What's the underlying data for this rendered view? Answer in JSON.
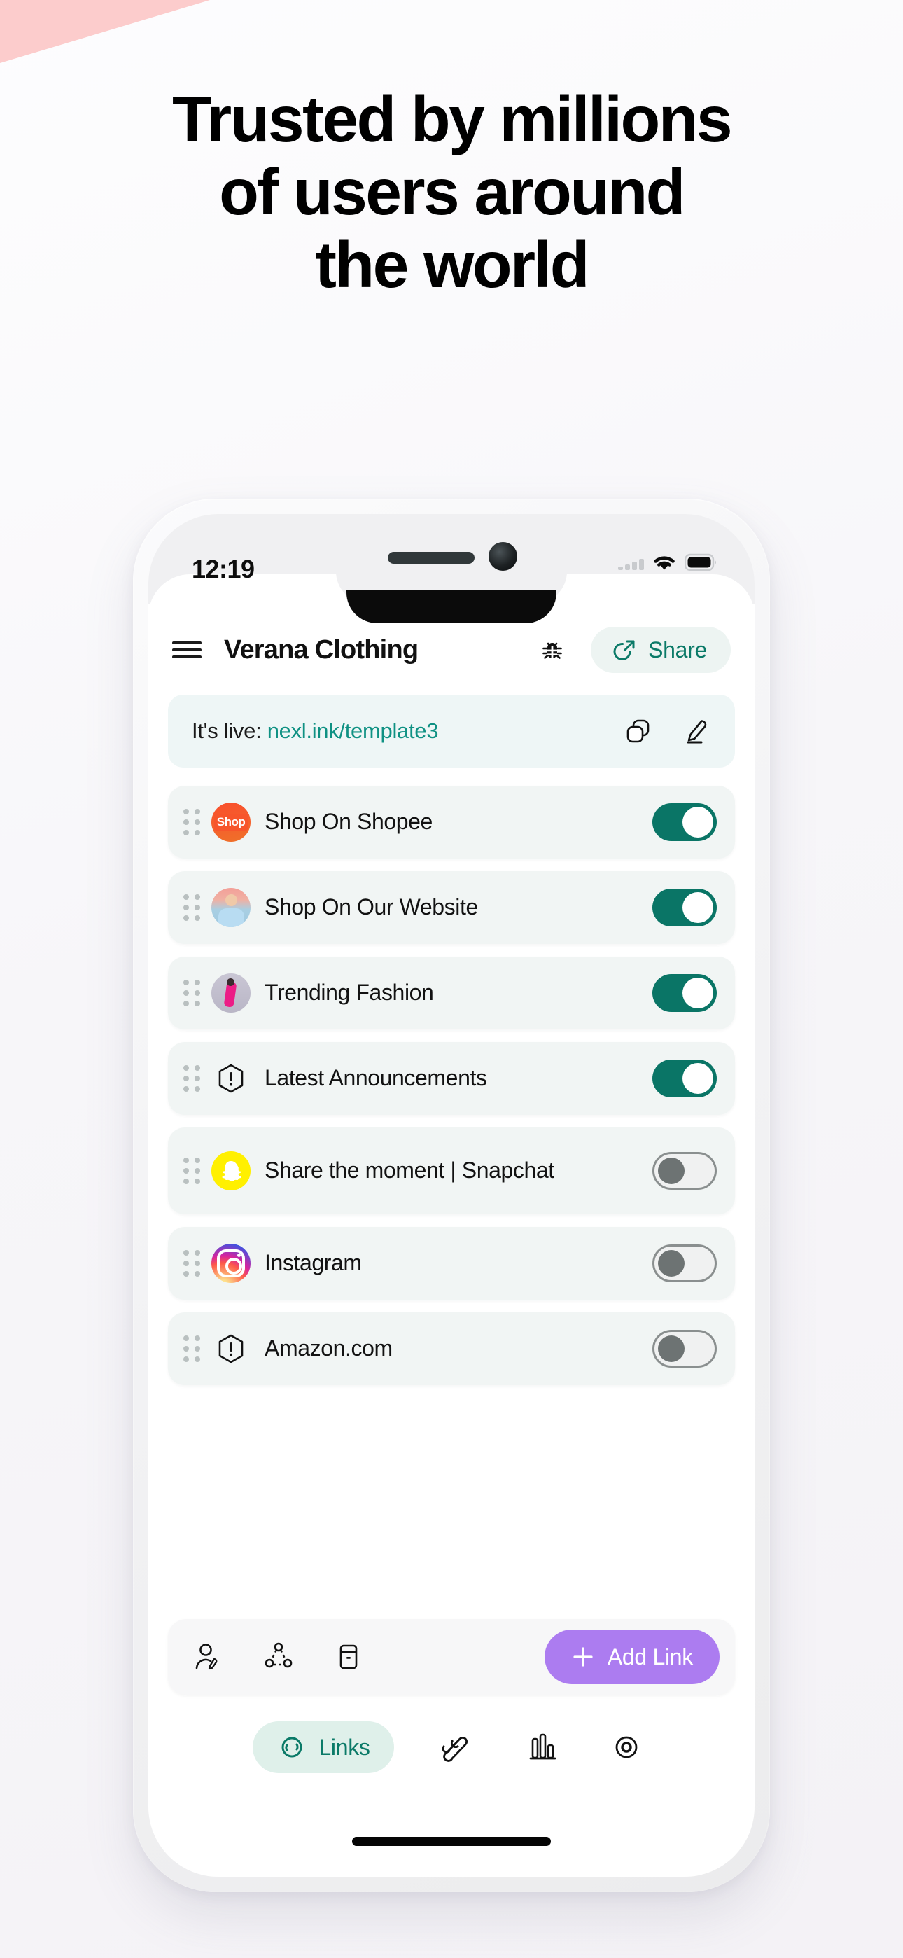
{
  "page": {
    "headline_lines": [
      "Trusted by millions",
      "of users around",
      "the world"
    ]
  },
  "colors": {
    "accent_teal": "#0a7566",
    "accent_teal_text": "#0b7a68",
    "link_teal": "#0f9183",
    "add_link_purple": "#ac7cf0",
    "pink_wedge": "#fccccc",
    "row_background": "#f1f5f4",
    "banner_background": "#eef6f6",
    "toggle_off_gray": "#6d7373"
  },
  "phone": {
    "status_bar": {
      "time": "12:19",
      "signal_icon": "signal-bars-icon",
      "wifi_icon": "wifi-icon",
      "battery_icon": "battery-full-icon"
    },
    "header": {
      "menu_icon": "hamburger-menu-icon",
      "title": "Verana Clothing",
      "bug_icon": "bug-icon",
      "share_icon": "share-arrow-icon",
      "share_label": "Share"
    },
    "live_banner": {
      "prefix": "It's live:",
      "url": "nexl.ink/template3",
      "copy_icon": "copy-icon",
      "edit_icon": "pencil-edit-icon"
    },
    "links": [
      {
        "label": "Shop On Shopee",
        "icon": "shopee-logo-icon",
        "avatar": "shopee",
        "enabled": true,
        "toggle_state": "on"
      },
      {
        "label": "Shop On Our Website",
        "icon": "person-photo-icon",
        "avatar": "person",
        "enabled": true,
        "toggle_state": "on"
      },
      {
        "label": "Trending Fashion",
        "icon": "fashion-photo-icon",
        "avatar": "fashion",
        "enabled": true,
        "toggle_state": "on"
      },
      {
        "label": "Latest Announcements",
        "icon": "alert-hexagon-icon",
        "avatar": "alert",
        "enabled": true,
        "toggle_state": "on"
      },
      {
        "label": "Share the moment | Snapchat",
        "icon": "snapchat-ghost-icon",
        "avatar": "snapchat",
        "enabled": false,
        "toggle_state": "off"
      },
      {
        "label": "Instagram",
        "icon": "instagram-logo-icon",
        "avatar": "instagram",
        "enabled": false,
        "toggle_state": "off"
      },
      {
        "label": "Amazon.com",
        "icon": "alert-hexagon-icon",
        "avatar": "alert",
        "enabled": false,
        "toggle_state": "off"
      }
    ],
    "action_bar": {
      "icons": [
        "edit-profile-icon",
        "share-network-icon",
        "archive-box-icon"
      ],
      "add_link_label": "Add Link",
      "add_link_plus_icon": "plus-icon"
    },
    "tabs": [
      {
        "label": "Links",
        "icon": "links-chain-icon",
        "active": true
      },
      {
        "label": "",
        "icon": "design-brush-icon",
        "active": false
      },
      {
        "label": "",
        "icon": "bar-chart-icon",
        "active": false
      },
      {
        "label": "",
        "icon": "eye-target-icon",
        "active": false
      }
    ]
  }
}
